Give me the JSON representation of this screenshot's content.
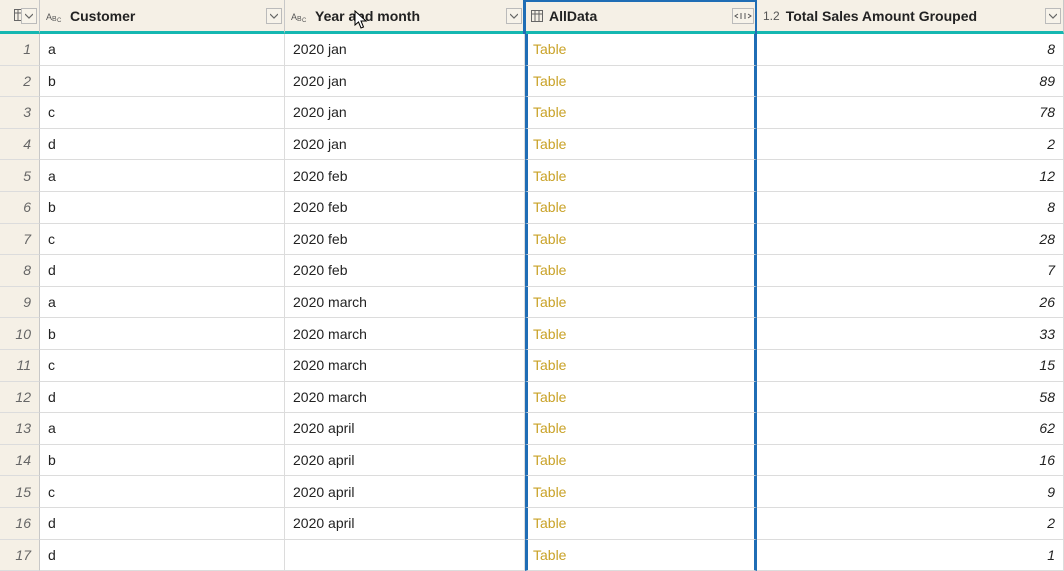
{
  "columns": {
    "customer_label": "Customer",
    "year_month_label": "Year and month",
    "alldata_label": "AllData",
    "total_label": "Total Sales Amount Grouped",
    "abc_icon": "text-type-icon",
    "table_icon": "table-type-icon",
    "num_icon": "decimal-type-icon",
    "num_prefix": "1.2"
  },
  "link_text": "Table",
  "rows": [
    {
      "n": "1",
      "customer": "a",
      "ym": "2020 jan",
      "total": "8"
    },
    {
      "n": "2",
      "customer": "b",
      "ym": "2020 jan",
      "total": "89"
    },
    {
      "n": "3",
      "customer": "c",
      "ym": "2020 jan",
      "total": "78"
    },
    {
      "n": "4",
      "customer": "d",
      "ym": "2020 jan",
      "total": "2"
    },
    {
      "n": "5",
      "customer": "a",
      "ym": "2020 feb",
      "total": "12"
    },
    {
      "n": "6",
      "customer": "b",
      "ym": "2020 feb",
      "total": "8"
    },
    {
      "n": "7",
      "customer": "c",
      "ym": "2020 feb",
      "total": "28"
    },
    {
      "n": "8",
      "customer": "d",
      "ym": "2020 feb",
      "total": "7"
    },
    {
      "n": "9",
      "customer": "a",
      "ym": "2020 march",
      "total": "26"
    },
    {
      "n": "10",
      "customer": "b",
      "ym": "2020 march",
      "total": "33"
    },
    {
      "n": "11",
      "customer": "c",
      "ym": "2020 march",
      "total": "15"
    },
    {
      "n": "12",
      "customer": "d",
      "ym": "2020 march",
      "total": "58"
    },
    {
      "n": "13",
      "customer": "a",
      "ym": "2020 april",
      "total": "62"
    },
    {
      "n": "14",
      "customer": "b",
      "ym": "2020 april",
      "total": "16"
    },
    {
      "n": "15",
      "customer": "c",
      "ym": "2020 april",
      "total": "9"
    },
    {
      "n": "16",
      "customer": "d",
      "ym": "2020 april",
      "total": "2"
    },
    {
      "n": "17",
      "customer": "d",
      "ym": "",
      "total": "1"
    }
  ]
}
